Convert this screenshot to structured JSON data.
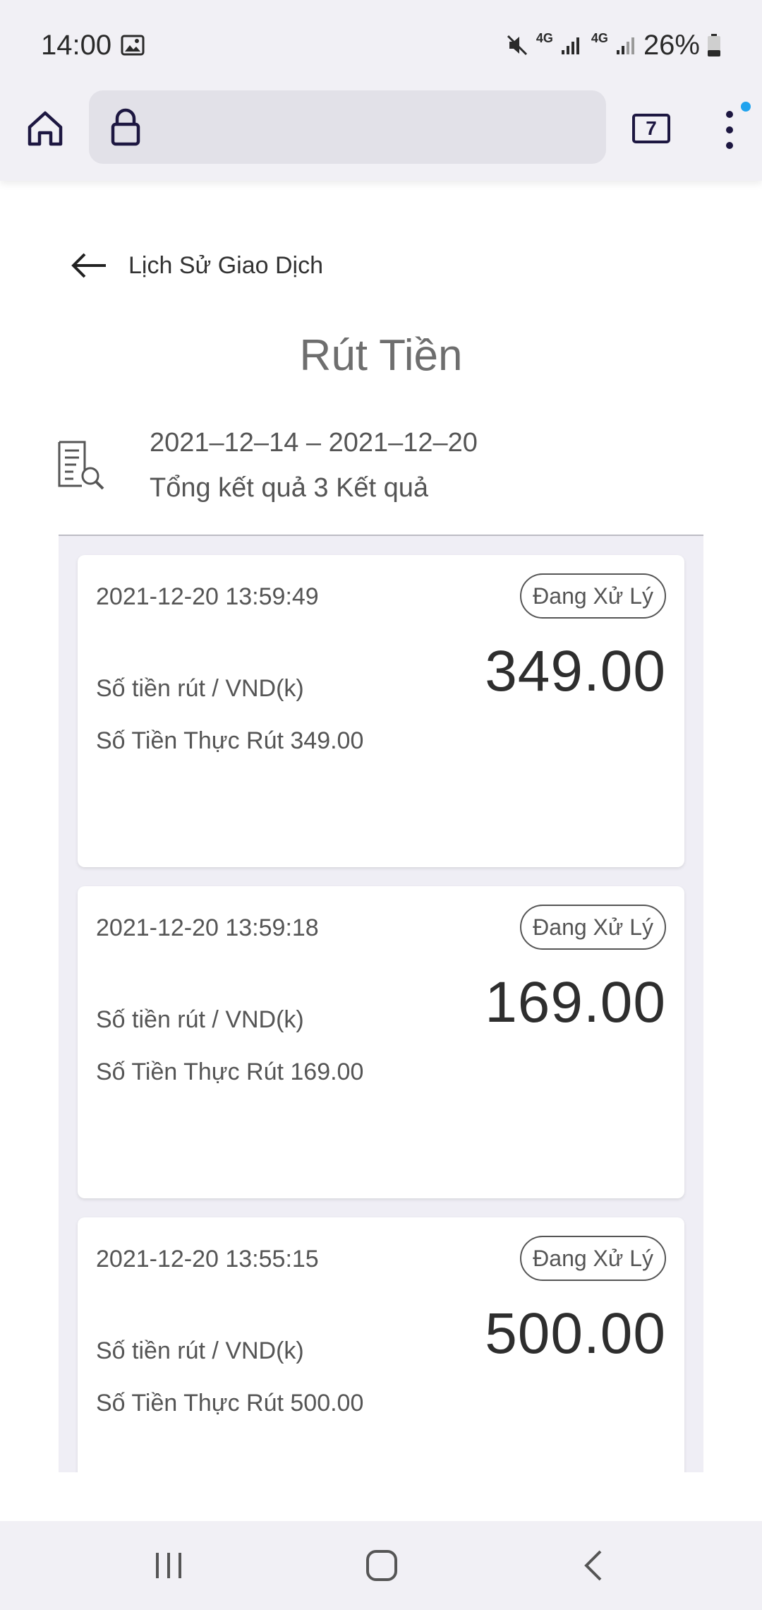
{
  "status_bar": {
    "time": "14:00",
    "battery": "26%",
    "network_label": "4G"
  },
  "browser": {
    "tab_count": "7"
  },
  "header": {
    "back_label": "Lịch Sử Giao Dịch",
    "title": "Rút Tiền"
  },
  "summary": {
    "date_range": "2021–12–14 – 2021–12–20",
    "total": "Tổng kết quả 3 Kết quả"
  },
  "transactions": [
    {
      "timestamp": "2021-12-20 13:59:49",
      "status": "Đang Xử Lý",
      "amount": "349.00",
      "unit_label": "Số tiền rút / VND(k)",
      "actual": "Số Tiền Thực Rút 349.00"
    },
    {
      "timestamp": "2021-12-20 13:59:18",
      "status": "Đang Xử Lý",
      "amount": "169.00",
      "unit_label": "Số tiền rút / VND(k)",
      "actual": "Số Tiền Thực Rút 169.00"
    },
    {
      "timestamp": "2021-12-20 13:55:15",
      "status": "Đang Xử Lý",
      "amount": "500.00",
      "unit_label": "Số tiền rút / VND(k)",
      "actual": "Số Tiền Thực Rút 500.00"
    }
  ],
  "colors": {
    "chrome_bg": "#f1f0f5",
    "list_bg": "#efeef5",
    "card_bg": "#ffffff",
    "accent_dot": "#20a3ee",
    "icon_dark": "#1d1741"
  }
}
